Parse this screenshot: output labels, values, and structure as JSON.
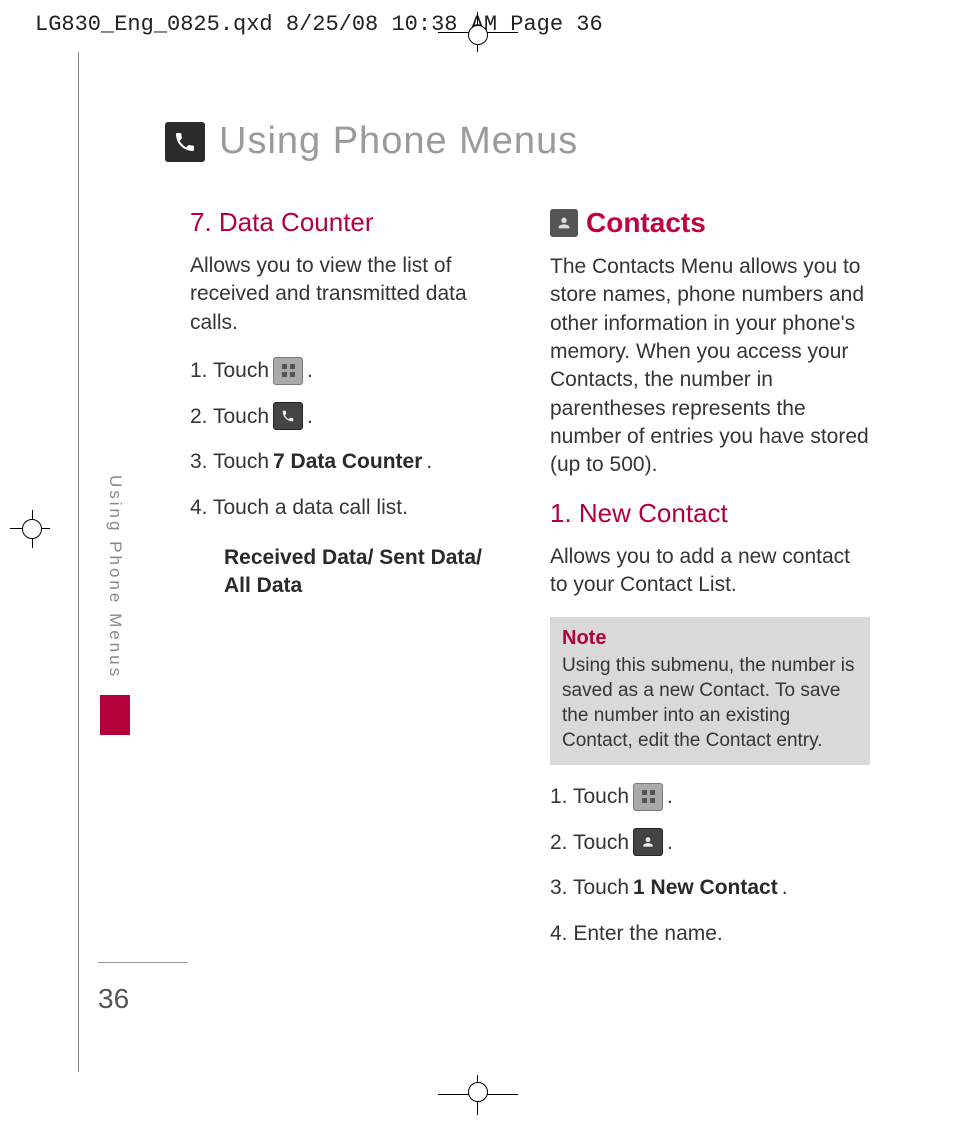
{
  "slug": "LG830_Eng_0825.qxd  8/25/08  10:38 AM  Page 36",
  "title": "Using Phone Menus",
  "side_label": "Using Phone Menus",
  "page_number": "36",
  "left": {
    "heading": "7. Data Counter",
    "intro": "Allows you to view the list of received and transmitted data calls.",
    "steps": {
      "s1_pre": "1. Touch ",
      "s1_post": ".",
      "s2_pre": "2. Touch ",
      "s2_post": ".",
      "s3_pre": "3. Touch ",
      "s3_bold": "7 Data Counter",
      "s3_post": ".",
      "s4": "4. Touch a data call list.",
      "s4_detail": "Received Data/ Sent Data/ All Data"
    }
  },
  "right": {
    "heading": "Contacts",
    "intro": "The Contacts Menu allows you to store names, phone numbers and other information in your phone's memory. When you access your Contacts, the number in parentheses represents the number of entries you have stored (up to 500).",
    "sub_heading": "1. New Contact",
    "sub_intro": "Allows you to add a new contact to your Contact List.",
    "note_title": "Note",
    "note_body": "Using this submenu, the number is saved as a new Contact. To save the number into an existing Contact, edit the Contact entry.",
    "steps": {
      "s1_pre": "1. Touch ",
      "s1_post": ".",
      "s2_pre": "2. Touch ",
      "s2_post": ".",
      "s3_pre": "3. Touch ",
      "s3_bold": "1 New Contact",
      "s3_post": ".",
      "s4": "4. Enter the name."
    }
  }
}
